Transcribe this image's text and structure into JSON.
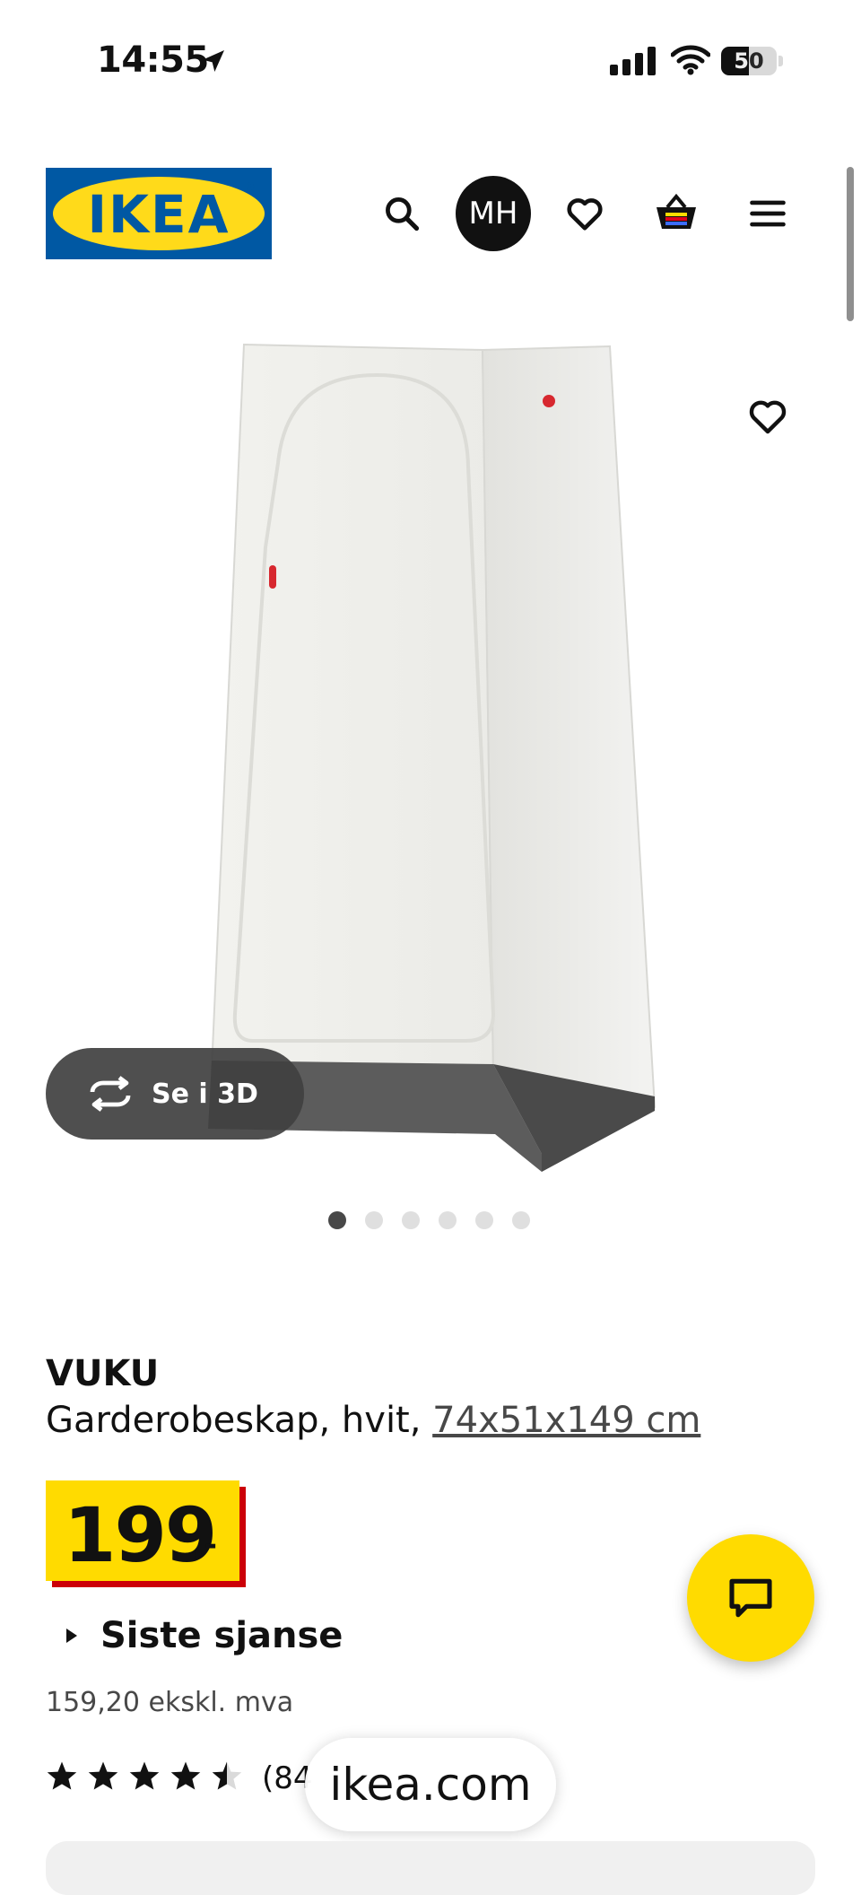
{
  "status_bar": {
    "time": "14:55",
    "battery": "50",
    "icons": [
      "location-arrow-icon",
      "signal-icon",
      "wifi-icon",
      "battery-icon"
    ]
  },
  "header": {
    "logo_text": "IKEA",
    "logo_reg": "®",
    "avatar_initials": "MH",
    "icons": [
      "search-icon",
      "heart-icon",
      "cart-icon",
      "menu-icon"
    ]
  },
  "gallery": {
    "view_3d_label": "Se i 3D",
    "dot_count": 6,
    "active_index": 0
  },
  "product": {
    "name": "VUKU",
    "description": "Garderobeskap, hvit, ",
    "dimensions": "74x51x149 cm",
    "price_integer": "199",
    "price_suffix": ",-",
    "promo_label": "Siste sjanse",
    "price_excl_vat": "159,20 ekskl. mva",
    "rating": 4.5,
    "rating_count": "(84"
  },
  "browser": {
    "url": "ikea.com"
  },
  "colors": {
    "brand_blue": "#0058a3",
    "brand_yellow": "#ffdb00",
    "price_shadow": "#cc0008"
  }
}
